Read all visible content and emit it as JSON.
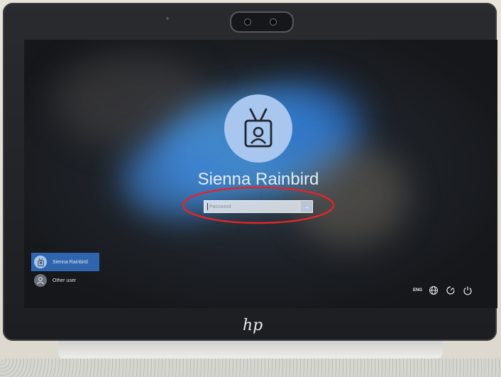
{
  "lock_screen": {
    "user_name": "Sienna Rainbird",
    "password_placeholder": "Password"
  },
  "user_list": [
    {
      "label": "Sienna Rainbird",
      "selected": true
    },
    {
      "label": "Other user",
      "selected": false
    }
  ],
  "system_tray": {
    "language": "ENG",
    "icons": [
      "network-icon",
      "accessibility-icon",
      "power-icon"
    ]
  },
  "hardware": {
    "brand_logo": "hp"
  },
  "colors": {
    "annotation": "#e0262a",
    "selected_user": "#326ebe",
    "avatar": "#a8c6ee"
  }
}
